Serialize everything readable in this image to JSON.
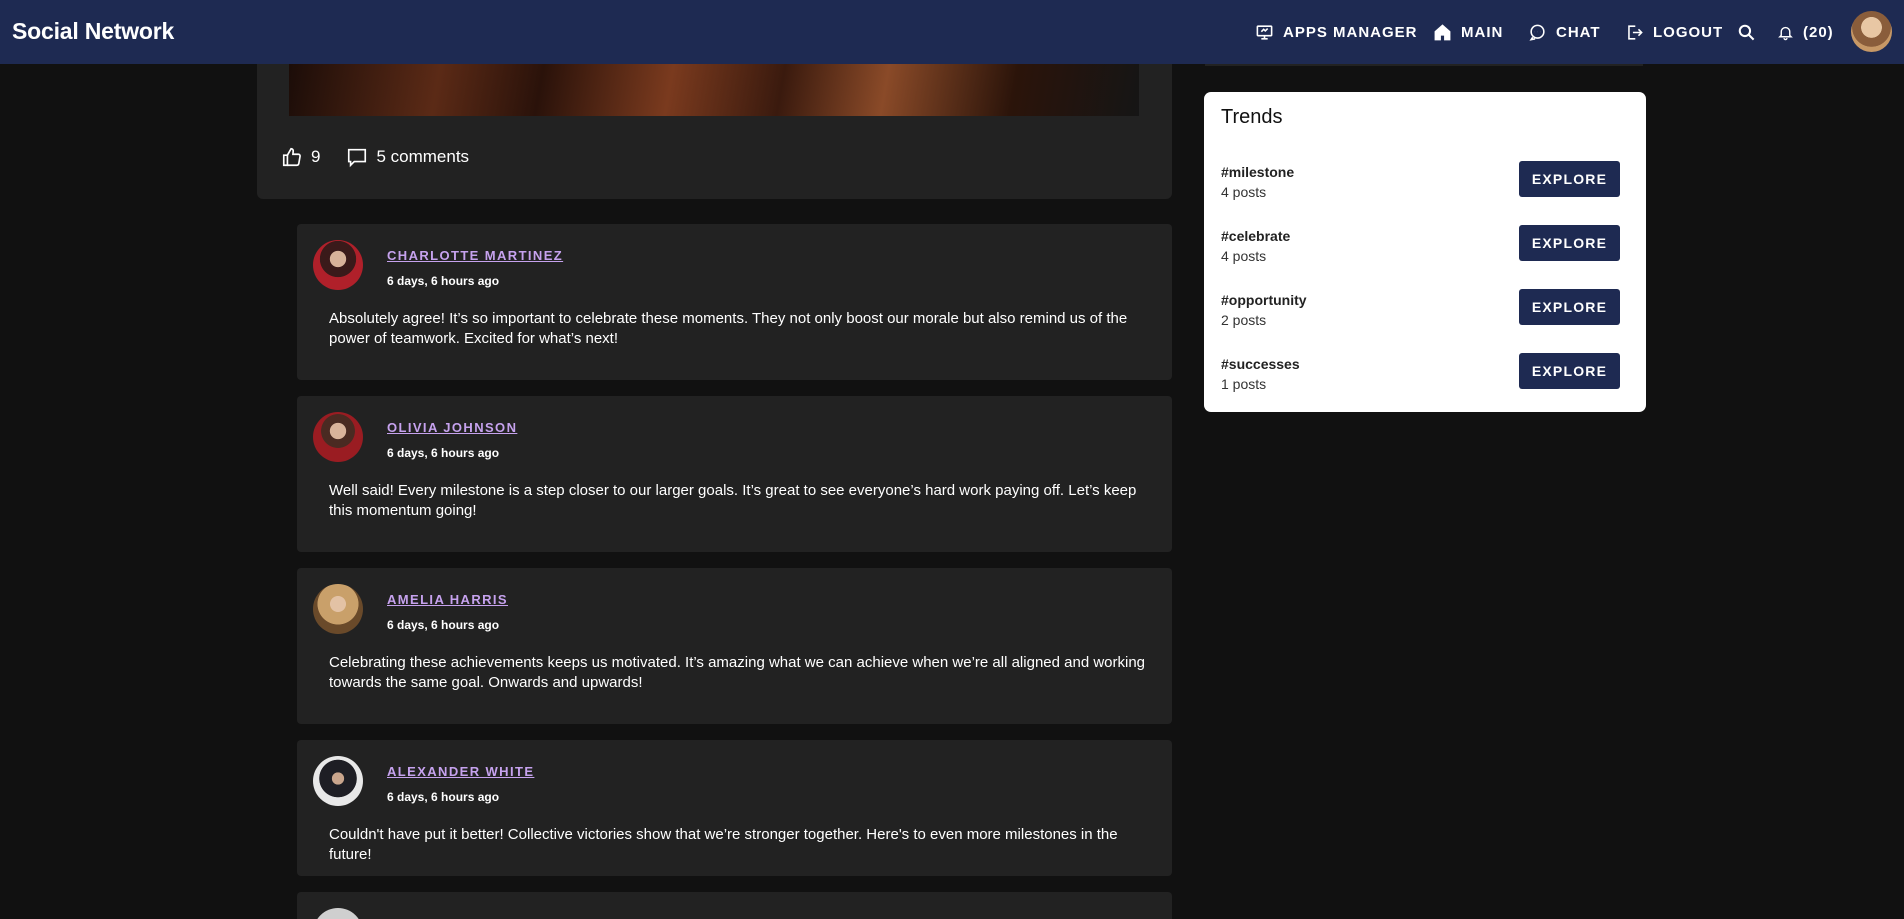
{
  "header": {
    "brand": "Social Network",
    "nav": [
      {
        "label": "APPS MANAGER",
        "icon": "monitor-icon"
      },
      {
        "label": "MAIN",
        "icon": "home-icon"
      },
      {
        "label": "CHAT",
        "icon": "chat-icon"
      },
      {
        "label": "LOGOUT",
        "icon": "logout-icon"
      }
    ],
    "notifications_count": "(20)"
  },
  "post": {
    "likes": "9",
    "comments_label": "5 comments"
  },
  "comments": [
    {
      "author": "CHARLOTTE MARTINEZ",
      "time": "6 days, 6 hours ago",
      "text": "Absolutely agree! It’s so important to celebrate these moments. They not only boost our morale but also remind us of the power of teamwork. Excited for what’s next!"
    },
    {
      "author": "OLIVIA JOHNSON",
      "time": "6 days, 6 hours ago",
      "text": "Well said! Every milestone is a step closer to our larger goals. It’s great to see everyone’s hard work paying off. Let’s keep this momentum going!"
    },
    {
      "author": "AMELIA HARRIS",
      "time": "6 days, 6 hours ago",
      "text": "Celebrating these achievements keeps us motivated. It’s amazing what we can achieve when we’re all aligned and working towards the same goal. Onwards and upwards!"
    },
    {
      "author": "ALEXANDER WHITE",
      "time": "6 days, 6 hours ago",
      "text": "Couldn't have put it better! Collective victories show that we’re stronger together. Here's to even more milestones in the future!"
    }
  ],
  "trends": {
    "title": "Trends",
    "items": [
      {
        "tag": "#milestone",
        "count": "4 posts",
        "button": "EXPLORE"
      },
      {
        "tag": "#celebrate",
        "count": "4 posts",
        "button": "EXPLORE"
      },
      {
        "tag": "#opportunity",
        "count": "2 posts",
        "button": "EXPLORE"
      },
      {
        "tag": "#successes",
        "count": "1 posts",
        "button": "EXPLORE"
      }
    ]
  },
  "colors": {
    "header_bg": "#1e2a52",
    "page_bg": "#111111",
    "card_bg": "#222222",
    "author_link": "#c6a2ee",
    "button_bg": "#1e2a52"
  }
}
